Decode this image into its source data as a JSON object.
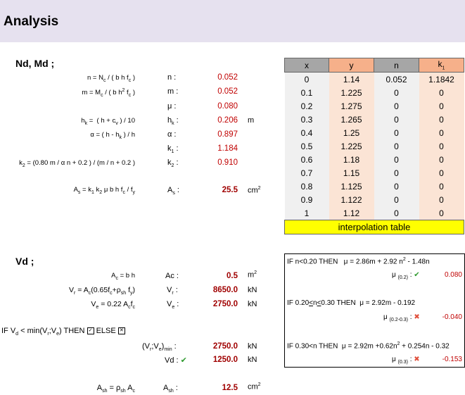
{
  "title": "Analysis",
  "section1": {
    "heading": "Nd, Md ;",
    "rows": [
      {
        "formula_html": "n = N<sub>c</sub> / ( b h f<sub>c</sub> )",
        "label": "n :",
        "value": "0.052",
        "unit": ""
      },
      {
        "formula_html": "m = M<sub>c</sub> / ( b h<sup>2</sup> f<sub>c</sub> )",
        "label": "m :",
        "value": "0.052",
        "unit": ""
      },
      {
        "formula_html": "",
        "label": "μ :",
        "value": "0.080",
        "unit": ""
      },
      {
        "formula_html": "h<sub>k</sub> = &nbsp;( h + c<sub>v</sub> ) / 10",
        "label": "h<sub>k</sub> :",
        "value": "0.206",
        "unit": "m"
      },
      {
        "formula_html": "α = ( h - h<sub>k</sub> ) / h",
        "label": "α :",
        "value": "0.897",
        "unit": ""
      },
      {
        "formula_html": "",
        "label": "k<sub>1</sub> :",
        "value": "1.184",
        "unit": ""
      },
      {
        "formula_html": "k<sub>2</sub> = (0.80 m / α n + 0.2 ) / (m / n + 0.2 )",
        "label": "k<sub>2</sub> :",
        "value": "0.910",
        "unit": ""
      }
    ],
    "as_formula_html": "A<sub>s</sub> = k<sub>1</sub> k<sub>2</sub> μ b h f<sub>c</sub> / f<sub>y</sub>",
    "as_label": "A<sub>s</sub> :",
    "as_value": "25.5",
    "as_unit": "cm<sup>2</sup>"
  },
  "table": {
    "headers": [
      "x",
      "y",
      "n",
      "k<sub>1</sub>"
    ],
    "rows": [
      [
        "0",
        "1.14",
        "0.052",
        "1.1842"
      ],
      [
        "0.1",
        "1.225",
        "0",
        "0"
      ],
      [
        "0.2",
        "1.275",
        "0",
        "0"
      ],
      [
        "0.3",
        "1.265",
        "0",
        "0"
      ],
      [
        "0.4",
        "1.25",
        "0",
        "0"
      ],
      [
        "0.5",
        "1.225",
        "0",
        "0"
      ],
      [
        "0.6",
        "1.18",
        "0",
        "0"
      ],
      [
        "0.7",
        "1.15",
        "0",
        "0"
      ],
      [
        "0.8",
        "1.125",
        "0",
        "0"
      ],
      [
        "0.9",
        "1.122",
        "0",
        "0"
      ],
      [
        "1",
        "1.12",
        "0",
        "0"
      ]
    ],
    "caption": "interpolation table"
  },
  "section2": {
    "heading": "Vd ;",
    "ac_formula_html": "A<sub>c</sub> = b h",
    "ac_label": "Ac :",
    "ac_value": "0.5",
    "ac_unit": "m<sup>2</sup>",
    "vr_formula_html": "V<sub>r</sub> = A<sub>c</sub>(0.65f<sub>c</sub>+ρ<sub>sh</sub> f<sub>y</sub>)",
    "vr_label": "V<sub>r</sub> :",
    "vr_value": "8650.0",
    "vr_unit": "kN",
    "ve_formula_html": "V<sub>e</sub> = 0.22 A<sub>c</sub>f<sub>c</sub>",
    "ve_label": "V<sub>e</sub> :",
    "ve_value": "2750.0",
    "ve_unit": "kN",
    "if_html": "IF V<sub>d</sub> &lt; min(V<sub>r</sub>;V<sub>e</sub>) THEN",
    "else_text": "ELSE",
    "min_label_html": "(V<sub>r</sub>;V<sub>e</sub>)<sub>min</sub> :",
    "min_value": "2750.0",
    "min_unit": "kN",
    "vd_label": "Vd :",
    "vd_value": "1250.0",
    "vd_unit": "kN",
    "ash_formula_html": "A<sub>sh</sub> = ρ<sub>sh</sub> A<sub>c</sub>",
    "ash_label": "A<sub>sh</sub> :",
    "ash_value": "12.5",
    "ash_unit": "cm<sup>2</sup>"
  },
  "mu_box": {
    "case1_html": "IF n&lt;0.20 THEN &nbsp;&nbsp;μ = 2.86m + 2.92 n<sup>2</sup> - 1.48n",
    "case1_label_html": "μ <sub>(0.2)</sub> :",
    "case1_value": "0.080",
    "case2_html": "IF 0.20<u>&lt;</u>n<u>&lt;</u>0.30 THEN &nbsp;μ = 2.92m - 0.192",
    "case2_label_html": "μ <sub>(0.2-0.3)</sub> :",
    "case2_value": "-0.040",
    "case3_html": "IF 0.30&lt;n THEN &nbsp;μ = 2.92m +0.62n<sup>2</sup> + 0.254n - 0.32",
    "case3_label_html": "μ <sub>(0.3)</sub> :",
    "case3_value": "-0.153"
  },
  "icons": {
    "check": "check-icon",
    "cross": "cross-icon",
    "checkbox": "checkbox-icon"
  },
  "colors": {
    "header_bg": "#e6e1ef",
    "value_red": "#c00000",
    "caption_yellow": "#ffff00",
    "y_col": "#fbe4d5"
  }
}
